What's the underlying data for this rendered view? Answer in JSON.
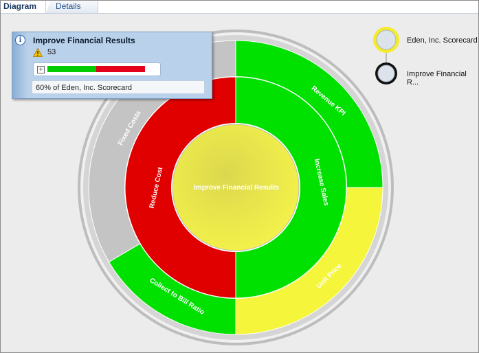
{
  "tabs": [
    {
      "label": "Diagram",
      "active": true
    },
    {
      "label": "Details",
      "active": false
    }
  ],
  "diagram": {
    "center": {
      "label": "Improve Financial Results",
      "status": "yellow"
    },
    "middle_ring": [
      {
        "label": "Increase Sales",
        "status": "green"
      },
      {
        "label": "Reduce Cost",
        "status": "red"
      }
    ],
    "outer_ring": [
      {
        "label": "Revenue KPI",
        "status": "green"
      },
      {
        "label": "Unit Price",
        "status": "yellow"
      },
      {
        "label": "Collect to Bill Ratio",
        "status": "green"
      },
      {
        "label": "Fixed Costs",
        "status": "gray"
      }
    ]
  },
  "legend": [
    {
      "label": "Eden, Inc. Scorecard",
      "ring_color": "#f4ec2a"
    },
    {
      "label": "Improve Financial R...",
      "ring_color": "#111111"
    }
  ],
  "popup": {
    "title": "Improve Financial Results",
    "score": "53",
    "progress_fraction": 0.5,
    "footer": "60% of Eden, Inc. Scorecard",
    "info_icon": "info-icon",
    "warning_icon": "warning-icon"
  },
  "colors": {
    "green": "#00e100",
    "red": "#e00000",
    "yellow": "#f5f53c",
    "gray": "#c4c4c4",
    "center": "#eae84a"
  }
}
